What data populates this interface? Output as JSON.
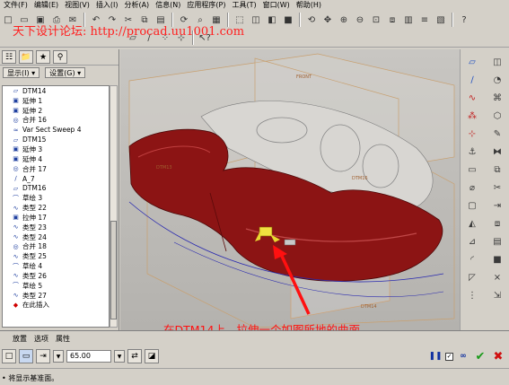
{
  "menu": [
    "文件(F)",
    "编辑(E)",
    "视图(V)",
    "插入(I)",
    "分析(A)",
    "信息(N)",
    "应用程序(P)",
    "工具(T)",
    "窗口(W)",
    "帮助(H)"
  ],
  "watermark": "天下设计论坛: http://procad.uu1001.com",
  "left_panel": {
    "show_menu": "显示(I) ▾",
    "settings_menu": "设置(G) ▾",
    "tree_items": [
      {
        "icon": "datum-plane-icon",
        "glyph": "▱",
        "label": "DTM14"
      },
      {
        "icon": "extrude-icon",
        "glyph": "▣",
        "label": "延伸 1"
      },
      {
        "icon": "extrude-icon",
        "glyph": "▣",
        "label": "延伸 2"
      },
      {
        "icon": "merge-icon",
        "glyph": "◎",
        "label": "合并 16"
      },
      {
        "icon": "sweep-icon",
        "glyph": "≈",
        "label": "Var Sect Sweep 4"
      },
      {
        "icon": "datum-plane-icon",
        "glyph": "▱",
        "label": "DTM15"
      },
      {
        "icon": "extrude-icon",
        "glyph": "▣",
        "label": "延伸 3"
      },
      {
        "icon": "extrude-icon",
        "glyph": "▣",
        "label": "延伸 4"
      },
      {
        "icon": "merge-icon",
        "glyph": "◎",
        "label": "合并 17"
      },
      {
        "icon": "axis-icon",
        "glyph": "∕",
        "label": "A_7"
      },
      {
        "icon": "datum-plane-icon",
        "glyph": "▱",
        "label": "DTM16"
      },
      {
        "icon": "sketch-icon",
        "glyph": "⌒",
        "label": "草绘 3"
      },
      {
        "icon": "type-icon",
        "glyph": "∿",
        "label": "类型 22"
      },
      {
        "icon": "extrude-icon",
        "glyph": "▣",
        "label": "拉伸 17"
      },
      {
        "icon": "type-icon",
        "glyph": "∿",
        "label": "类型 23"
      },
      {
        "icon": "type-icon",
        "glyph": "∿",
        "label": "类型 24"
      },
      {
        "icon": "merge-icon",
        "glyph": "◎",
        "label": "合并 18"
      },
      {
        "icon": "type-icon",
        "glyph": "∿",
        "label": "类型 25"
      },
      {
        "icon": "sketch-icon",
        "glyph": "⌒",
        "label": "草绘 4"
      },
      {
        "icon": "type-icon",
        "glyph": "∿",
        "label": "类型 26"
      },
      {
        "icon": "sketch-icon",
        "glyph": "⌒",
        "label": "草绘 5"
      },
      {
        "icon": "type-icon",
        "glyph": "∿",
        "label": "类型 27"
      },
      {
        "icon": "insert-here-icon",
        "glyph": "◆",
        "label": "在此插入"
      }
    ]
  },
  "viewport_labels": {
    "front": "FRONT",
    "dtm13": "DTM13",
    "dtm16": "DTM16",
    "dtm14": "DTM14"
  },
  "dashboard": {
    "tabs": [
      "放置",
      "选项",
      "属性"
    ],
    "depth_value": "65.00"
  },
  "status_message": "• 将显示基准面。",
  "callout": "在DTM14上，拉伸一个如图所地的曲面"
}
